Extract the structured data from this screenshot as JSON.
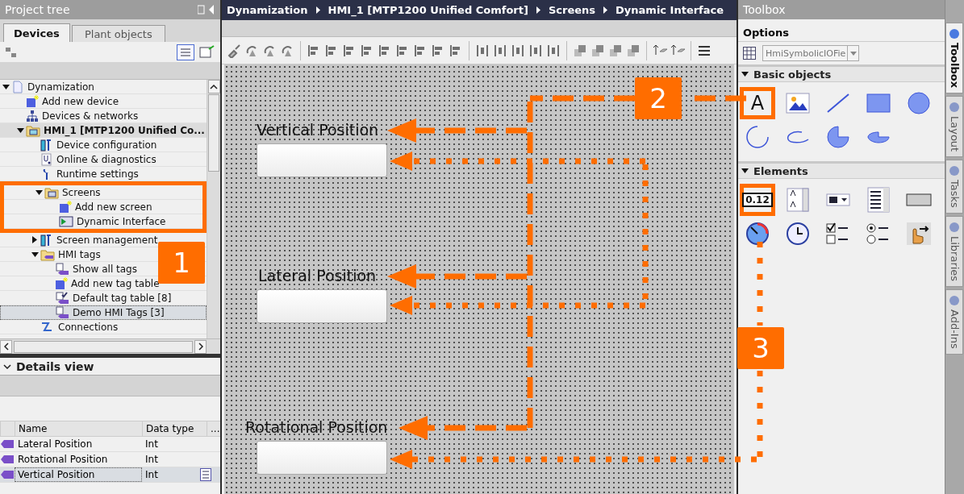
{
  "project_tree": {
    "title": "Project tree",
    "tabs": [
      {
        "label": "Devices",
        "selected": true
      },
      {
        "label": "Plant objects",
        "selected": false
      }
    ],
    "items": [
      {
        "label": "Dynamization",
        "kind": "project",
        "expanded": true,
        "selected": false,
        "children": [
          {
            "label": "Add new device",
            "kind": "add",
            "selected": false
          },
          {
            "label": "Devices & networks",
            "kind": "network",
            "selected": false
          },
          {
            "label": "HMI_1 [MTP1200 Unified Co...",
            "kind": "device",
            "expanded": true,
            "selected": false,
            "emphasized": true,
            "children": [
              {
                "label": "Device configuration",
                "kind": "config",
                "selected": false
              },
              {
                "label": "Online & diagnostics",
                "kind": "diagnostics",
                "selected": false
              },
              {
                "label": "Runtime settings",
                "kind": "wrench",
                "selected": false
              },
              {
                "label": "Screens",
                "kind": "folder",
                "expanded": true,
                "selected": false,
                "highlighted": true,
                "children": [
                  {
                    "label": "Add new screen",
                    "kind": "add",
                    "selected": false
                  },
                  {
                    "label": "Dynamic Interface",
                    "kind": "screen",
                    "selected": false
                  }
                ]
              },
              {
                "label": "Screen management",
                "kind": "config",
                "expanded": false,
                "selected": false
              },
              {
                "label": "HMI tags",
                "kind": "tagfolder",
                "expanded": true,
                "selected": false,
                "children": [
                  {
                    "label": "Show all tags",
                    "kind": "tags",
                    "selected": false
                  },
                  {
                    "label": "Add new tag table",
                    "kind": "add",
                    "selected": false
                  },
                  {
                    "label": "Default tag table [8]",
                    "kind": "tagtable",
                    "selected": false
                  },
                  {
                    "label": "Demo HMI Tags [3]",
                    "kind": "tags",
                    "selected": true
                  }
                ]
              },
              {
                "label": "Connections",
                "kind": "connection",
                "selected": false
              }
            ]
          }
        ]
      }
    ]
  },
  "details_view": {
    "title": "Details view",
    "columns": [
      "Name",
      "Data type",
      "..."
    ],
    "rows": [
      {
        "name": "Lateral Position",
        "data_type": "Int",
        "selected": false
      },
      {
        "name": "Rotational Position",
        "data_type": "Int",
        "selected": false
      },
      {
        "name": "Vertical Position",
        "data_type": "Int",
        "selected": true
      }
    ]
  },
  "breadcrumb": [
    "Dynamization",
    "HMI_1 [MTP1200 Unified Comfort]",
    "Screens",
    "Dynamic Interface"
  ],
  "screen_objects": [
    {
      "label": "Vertical Position"
    },
    {
      "label": "Lateral Position"
    },
    {
      "label": "Rotational Position"
    }
  ],
  "toolbox": {
    "title": "Toolbox",
    "options_title": "Options",
    "object_type": "HmiSymbolicIOFie",
    "sections": [
      {
        "title": "Basic objects",
        "expanded": true,
        "items": [
          {
            "kind": "text",
            "glyph": "A",
            "highlighted": true
          },
          {
            "kind": "image",
            "highlighted": false
          },
          {
            "kind": "line",
            "highlighted": false
          },
          {
            "kind": "rectangle",
            "highlighted": false
          },
          {
            "kind": "circle",
            "highlighted": false
          },
          {
            "kind": "arc",
            "highlighted": false
          },
          {
            "kind": "elliptical_arc",
            "highlighted": false
          },
          {
            "kind": "pie",
            "highlighted": false
          },
          {
            "kind": "elliptical_pie",
            "highlighted": false
          }
        ]
      },
      {
        "title": "Elements",
        "expanded": true,
        "items": [
          {
            "kind": "io_field",
            "glyph": "0.12",
            "highlighted": true
          },
          {
            "kind": "text_list",
            "highlighted": false
          },
          {
            "kind": "symbolic_io",
            "highlighted": false
          },
          {
            "kind": "list_box",
            "highlighted": false
          },
          {
            "kind": "button",
            "highlighted": false
          },
          {
            "kind": "gauge",
            "highlighted": false
          },
          {
            "kind": "clock",
            "highlighted": false
          },
          {
            "kind": "check_box",
            "highlighted": false
          },
          {
            "kind": "radio_button",
            "highlighted": false
          },
          {
            "kind": "touch_area",
            "highlighted": false
          }
        ]
      }
    ]
  },
  "side_tabs": [
    {
      "label": "Toolbox",
      "selected": true
    },
    {
      "label": "Layout",
      "selected": false
    },
    {
      "label": "Tasks",
      "selected": false
    },
    {
      "label": "Libraries",
      "selected": false
    },
    {
      "label": "Add-Ins",
      "selected": false
    }
  ],
  "callouts": [
    {
      "number": "1"
    },
    {
      "number": "2"
    },
    {
      "number": "3"
    }
  ]
}
